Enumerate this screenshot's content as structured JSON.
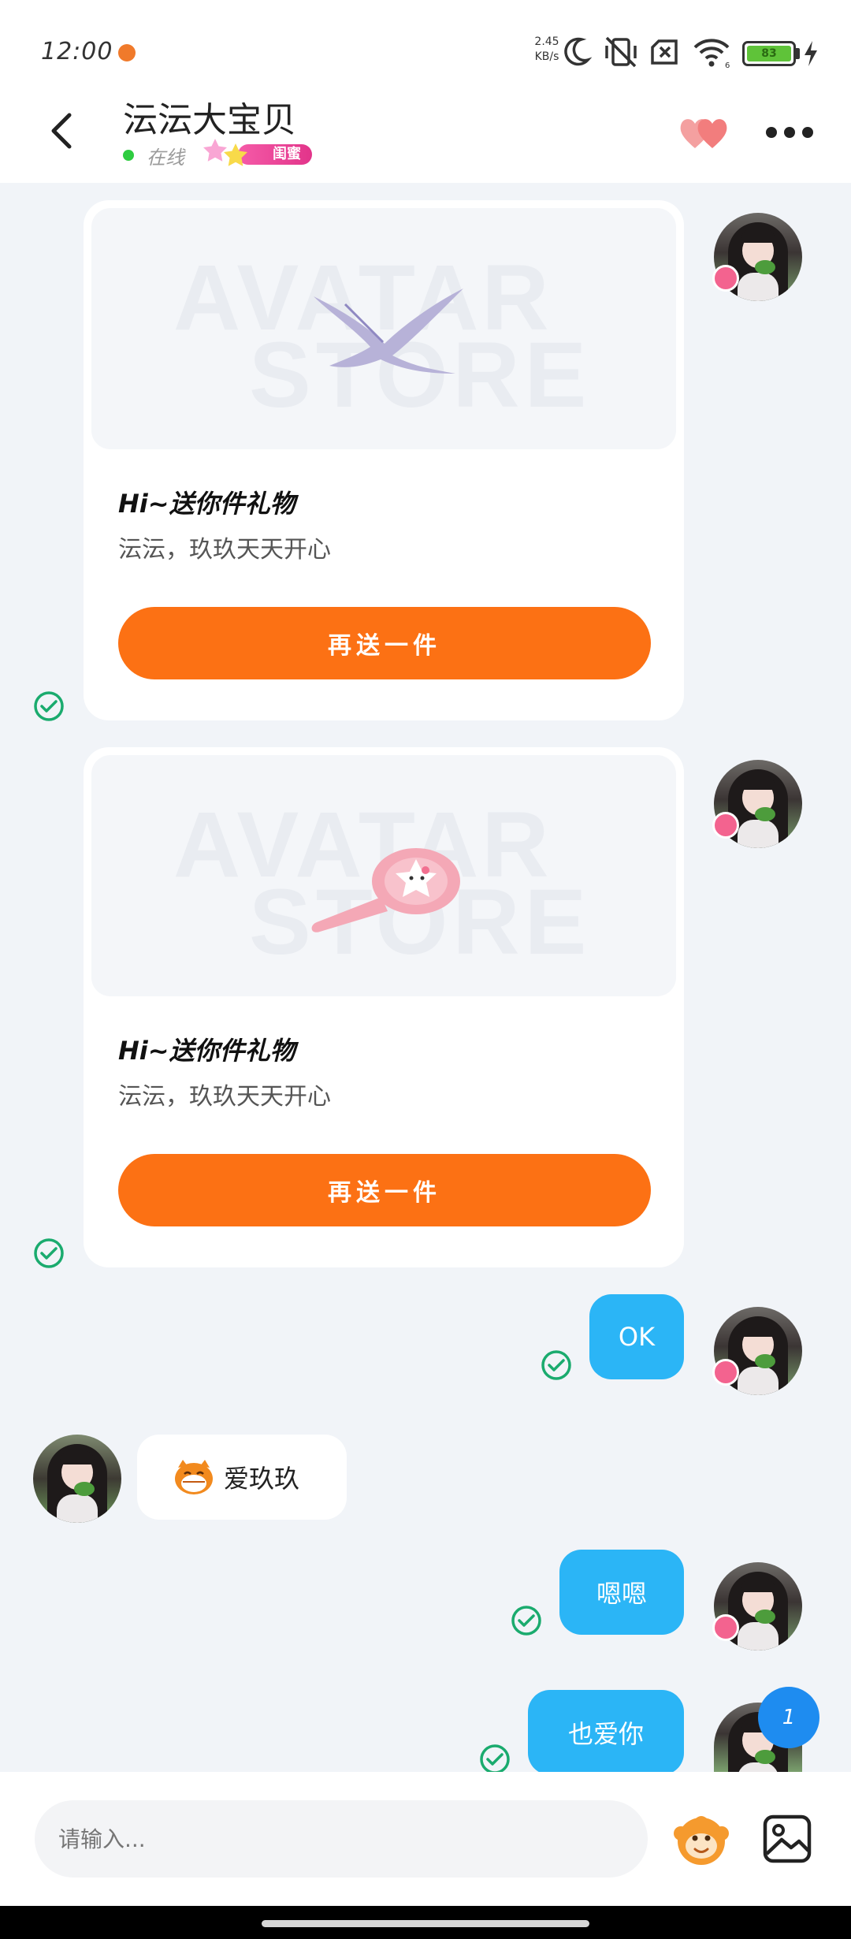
{
  "status_bar": {
    "time": "12:00",
    "net_speed_value": "2.45",
    "net_speed_unit": "KB/s",
    "battery_level": "83",
    "icons": [
      "moon-icon",
      "vibrate-off-icon",
      "no-sim-icon",
      "wifi-icon",
      "battery-icon",
      "charging-icon"
    ]
  },
  "header": {
    "name": "沄沄大宝贝",
    "online_status": "在线",
    "badge_text": "闺蜜"
  },
  "messages": {
    "gift_1": {
      "title": "Hi~送你件礼物",
      "subtitle": "沄沄，玖玖天天开心",
      "button": "再送一件",
      "watermark_line1": "AVATAR",
      "watermark_line2": "STORE",
      "item_icon": "dove-icon"
    },
    "gift_2": {
      "title": "Hi~送你件礼物",
      "subtitle": "沄沄，玖玖天天开心",
      "button": "再送一件",
      "watermark_line1": "AVATAR",
      "watermark_line2": "STORE",
      "item_icon": "spoon-icon"
    },
    "msg_ok": "OK",
    "msg_love_jiujiu": "爱玖玖",
    "msg_enen": "嗯嗯",
    "msg_love_you_too": "也爱你"
  },
  "unread_count": "1",
  "input": {
    "placeholder": "请输入..."
  },
  "colors": {
    "accent_orange": "#FC7114",
    "outgoing_bubble": "#2BB5F6",
    "check_green": "#1AAB6E",
    "online_green": "#2ECC40",
    "badge_pink": "#E2348A"
  }
}
